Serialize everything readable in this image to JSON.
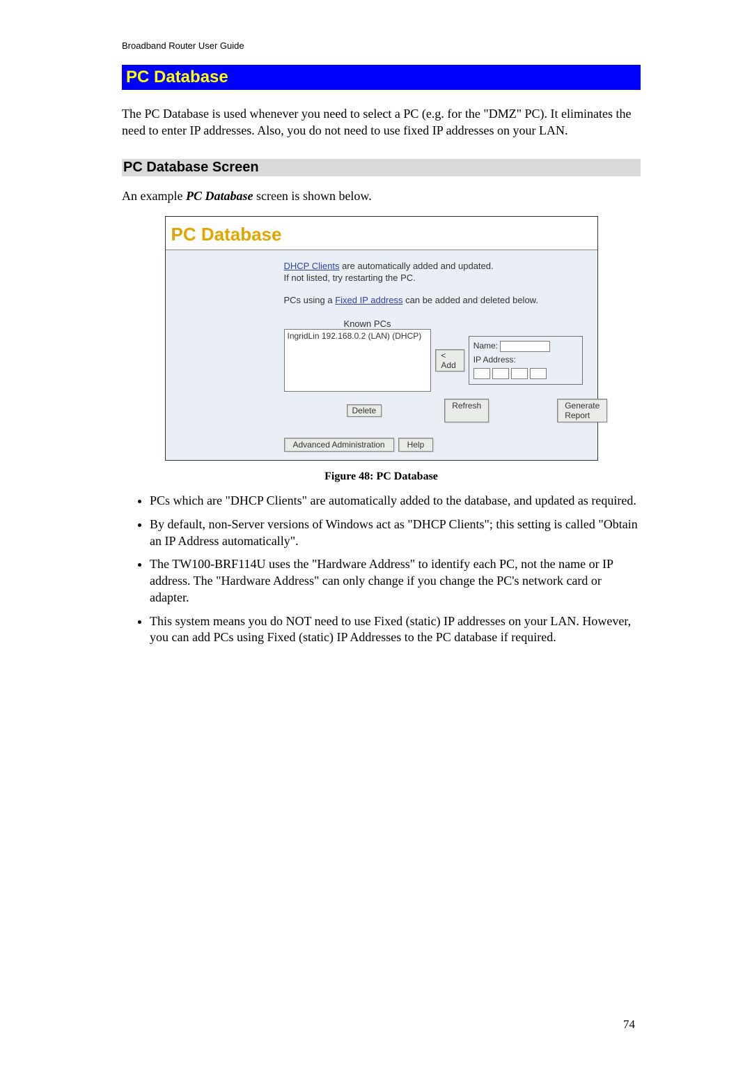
{
  "doc_header": "Broadband Router User Guide",
  "section_title": "PC Database",
  "intro_text": "The PC Database is used whenever you need to select a PC (e.g. for the \"DMZ\" PC). It eliminates the need to enter IP addresses. Also, you do not need to use fixed IP addresses on your LAN.",
  "subhead": "PC Database Screen",
  "example_pre": "An example ",
  "example_bold": "PC Database",
  "example_post": " screen is shown below.",
  "shot": {
    "title": "PC Database",
    "line1_link": "DHCP Clients",
    "line1_rest": " are automatically added and updated.",
    "line2": "If not listed, try restarting the PC.",
    "line3_pre": "PCs using a ",
    "line3_link": "Fixed IP address",
    "line3_post": " can be added and deleted below.",
    "known_label": "Known PCs",
    "known_item": "IngridLin 192.168.0.2 (LAN) (DHCP)",
    "add_btn": "< Add",
    "name_label": "Name:",
    "ip_label": "IP Address:",
    "delete_btn": "Delete",
    "refresh_btn": "Refresh",
    "report_btn": "Generate Report",
    "advadmin_btn": "Advanced Administration",
    "help_btn": "Help"
  },
  "figure_caption": "Figure 48: PC Database",
  "bullets": [
    "PCs which are \"DHCP Clients\" are automatically added to the database, and updated as required.",
    "By default, non-Server versions of Windows act as \"DHCP Clients\"; this setting is called \"Obtain an IP Address automatically\".",
    "The TW100-BRF114U uses the \"Hardware Address\" to identify each PC, not the name or IP address. The \"Hardware Address\" can only change if you change the PC's network card or adapter.",
    "This system means you do NOT need to use Fixed (static) IP addresses on your LAN. However, you can add PCs using Fixed (static) IP Addresses to the PC database if required."
  ],
  "page_number": "74"
}
